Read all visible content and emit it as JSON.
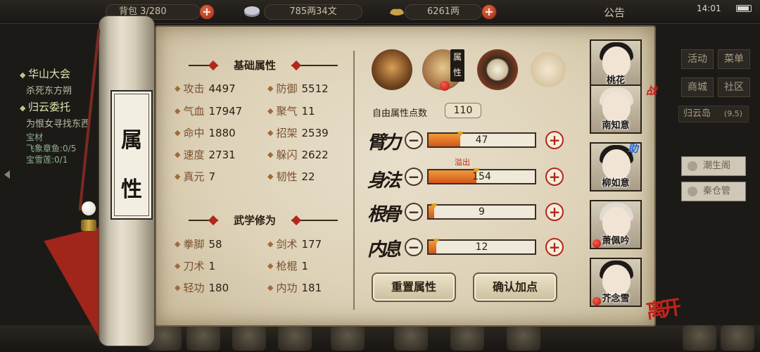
{
  "topbar": {
    "bag_count": "背包 3/280",
    "coins": "785两34文",
    "silver": "6261两",
    "plus": "+",
    "notice": "公告",
    "time": "14:01"
  },
  "quests": [
    {
      "title": "华山大会",
      "sub": "杀死东方朔",
      "details": []
    },
    {
      "title": "归云委托",
      "sub": "为恨女寻找东西",
      "details": [
        "宝材",
        "飞象章鱼:0/5",
        "宝雪莲:0/1"
      ]
    }
  ],
  "scroll_label": [
    "属",
    "性"
  ],
  "sections": {
    "basic_title": "基础属性",
    "martial_title": "武学修为"
  },
  "basic_stats": [
    {
      "name": "攻击",
      "value": "4497"
    },
    {
      "name": "防御",
      "value": "5512"
    },
    {
      "name": "气血",
      "value": "17947"
    },
    {
      "name": "聚气",
      "value": "11"
    },
    {
      "name": "命中",
      "value": "1880"
    },
    {
      "name": "招架",
      "value": "2539"
    },
    {
      "name": "速度",
      "value": "2731"
    },
    {
      "name": "躲闪",
      "value": "2622"
    },
    {
      "name": "真元",
      "value": "7"
    },
    {
      "name": "韧性",
      "value": "22"
    }
  ],
  "martial_stats": [
    {
      "name": "拳脚",
      "value": "58"
    },
    {
      "name": "剑术",
      "value": "177"
    },
    {
      "name": "刀术",
      "value": "1"
    },
    {
      "name": "枪棍",
      "value": "1"
    },
    {
      "name": "轻功",
      "value": "180"
    },
    {
      "name": "内功",
      "value": "181"
    }
  ],
  "tabs": {
    "icons": [
      "hat-icon",
      "attribute-scroll-icon",
      "bagua-icon",
      "body-icon"
    ],
    "active_tag": "属性"
  },
  "free_points": {
    "label": "自由属性点数",
    "value": "110"
  },
  "attributes": [
    {
      "name": "臂力",
      "value": "47",
      "fill": 0.3
    },
    {
      "name": "身法",
      "value": "154",
      "fill": 0.45,
      "overflow": "溢出"
    },
    {
      "name": "根骨",
      "value": "9",
      "fill": 0.05
    },
    {
      "name": "内息",
      "value": "12",
      "fill": 0.07
    }
  ],
  "buttons": {
    "minus": "−",
    "plus": "+",
    "reset": "重置属性",
    "confirm": "确认加点"
  },
  "party": [
    {
      "name": "桃花",
      "tag": "",
      "dot": false
    },
    {
      "name": "南知意",
      "tag": "战",
      "dot": false
    },
    {
      "name": "柳如意",
      "tag": "助",
      "dot": false
    },
    {
      "name": "萧佩吟",
      "tag": "",
      "dot": true
    },
    {
      "name": "芥念雪",
      "tag": "",
      "dot": true
    }
  ],
  "leave_label": "离开",
  "right_menu": [
    "活动",
    "菜单",
    "商城",
    "社区"
  ],
  "region": {
    "name": "归云岛",
    "coords": "(9,5)"
  },
  "npcs": [
    "潮生阁",
    "秦仓管"
  ],
  "colors": {
    "accent_red": "#b0281a",
    "bar_fill": "#e07a2a",
    "parchment": "#e2d8c2"
  }
}
